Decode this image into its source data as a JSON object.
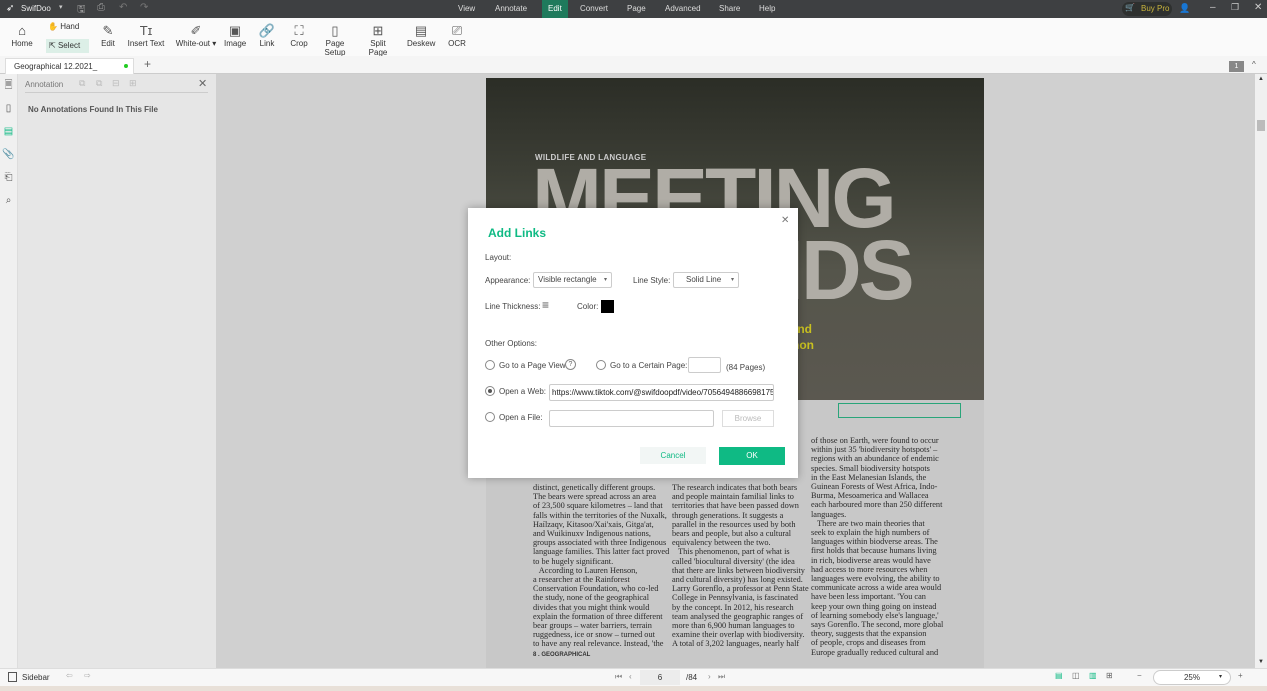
{
  "app": {
    "name": "SwifDoo",
    "buy_pro": "Buy Pro"
  },
  "menu": [
    "View",
    "Annotate",
    "Edit",
    "Convert",
    "Page",
    "Advanced",
    "Share",
    "Help"
  ],
  "menu_active": "Edit",
  "toolbar": {
    "home": "Home",
    "hand": "Hand",
    "select": "Select",
    "edit": "Edit",
    "insert_text": "Insert Text",
    "white_out": "White-out",
    "image": "Image",
    "link": "Link",
    "crop": "Crop",
    "page_setup": "Page Setup",
    "split_page": "Split Page",
    "deskew": "Deskew",
    "ocr": "OCR"
  },
  "tab": {
    "name": "Geographical 12.2021_",
    "add": "+"
  },
  "page_badge": "1",
  "annotation": {
    "title": "Annotation",
    "empty": "No Annotations Found In This File"
  },
  "document": {
    "kicker": "WILDLIFE AND LANGUAGE",
    "headline_1": "MEETING",
    "headline_2": "MINDS",
    "deck_1": "rs and",
    "deck_2": "non",
    "footer": "8 . GEOGRAPHICAL",
    "col1": [
      "distinct, genetically different groups.",
      "The bears were spread across an area",
      "of 23,500 square kilometres – land that",
      "falls within the territories of the Nuxalk,",
      "Haílzaqv, Kitasoo/Xai'xais, Gitga'at,",
      "and Wuikinuxv Indigenous nations,",
      "groups associated with three Indigenous",
      "language families. This latter fact proved",
      "to be hugely significant.",
      "   According to Lauren Henson,",
      "a researcher at the Rainforest",
      "Conservation Foundation, who co-led",
      "the study, none of the geographical",
      "divides that you might think would",
      "explain the formation of three different",
      "bear groups – water barriers, terrain",
      "ruggedness, ice or snow – turned out",
      "to have any real relevance. Instead, 'the"
    ],
    "col2": [
      "The research indicates that both bears",
      "and people maintain familial links to",
      "territories that have been passed down",
      "through generations. It suggests a",
      "parallel in the resources used by both",
      "bears and people, but also a cultural",
      "equivalency between the two.",
      "   This phenomenon, part of what is",
      "called 'biocultural diversity' (the idea",
      "that there are links between biodiversity",
      "and cultural diversity) has long existed.",
      "Larry Gorenflo, a professor at Penn State",
      "College in Pennsylvania, is fascinated",
      "by the concept. In 2012, his research",
      "team analysed the geographic ranges of",
      "more than 6,900 human languages to",
      "examine their overlap with biodiversity.",
      "A total of 3,202 languages, nearly half"
    ],
    "col3": [
      "of those on Earth, were found to occur",
      "within just 35 'biodiversity hotspots' –",
      "regions with an abundance of endemic",
      "species. Small biodiversity hotspots",
      "in the East Melanesian Islands, the",
      "Guinean Forests of West Africa, Indo-",
      "Burma, Mesoamerica and Wallacea",
      "each harboured more than 250 different",
      "languages.",
      "   There are two main theories that",
      "seek to explain the high numbers of",
      "languages within biodverse areas. The",
      "first holds that because humans living",
      "in rich, biodiverse areas would have",
      "had access to more resources when",
      "languages were evolving, the ability to",
      "communicate across a wide area would",
      "have been less important. 'You can",
      "keep your own thing going on instead",
      "of learning somebody else's language,'",
      "says Gorenflo. The second, more global",
      "theory, suggests that the expansion",
      "of people, crops and diseases from",
      "Europe gradually reduced cultural and"
    ]
  },
  "dialog": {
    "title": "Add Links",
    "layout": "Layout:",
    "appearance_label": "Appearance:",
    "appearance_value": "Visible rectangle",
    "line_style_label": "Line Style:",
    "line_style_value": "Solid Line",
    "line_thickness_label": "Line Thickness:",
    "color_label": "Color:",
    "color_value": "#000000",
    "other_options": "Other Options:",
    "go_page_view": "Go to a Page View",
    "help": "?",
    "go_certain_page": "Go to a Certain Page:",
    "page_input": "",
    "pages_note": "(84 Pages)",
    "open_web": "Open a Web:",
    "web_url": "https://www.tiktok.com/@swifdoopdf/video/7056494886698175",
    "open_file": "Open a File:",
    "file_path": "",
    "browse": "Browse",
    "selected_option": "open_web",
    "cancel": "Cancel",
    "ok": "OK"
  },
  "status": {
    "sidebar": "Sidebar",
    "current_page": "6",
    "total_pages": "/84",
    "zoom": "25%"
  },
  "colors": {
    "accent": "#0fba84",
    "title_bar": "#3e4042"
  }
}
